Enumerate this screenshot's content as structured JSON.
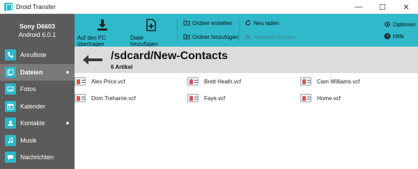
{
  "window": {
    "title": "Droid Transfer",
    "controls": {
      "minimize": "—",
      "maximize": "☐",
      "close": "✕"
    }
  },
  "device": {
    "name": "Sony D6603",
    "os": "Android 6.0.1"
  },
  "sidebar": {
    "items": [
      {
        "label": "Anrufliste",
        "icon": "phone-icon",
        "active": false,
        "dot": false
      },
      {
        "label": "Dateien",
        "icon": "files-icon",
        "active": true,
        "dot": true
      },
      {
        "label": "Fotos",
        "icon": "photos-icon",
        "active": false,
        "dot": false
      },
      {
        "label": "Kalender",
        "icon": "calendar-icon",
        "active": false,
        "dot": false
      },
      {
        "label": "Kontakte",
        "icon": "contacts-icon",
        "active": false,
        "dot": true
      },
      {
        "label": "Musik",
        "icon": "music-icon",
        "active": false,
        "dot": false
      },
      {
        "label": "Nachrichten",
        "icon": "messages-icon",
        "active": false,
        "dot": false
      }
    ]
  },
  "toolbar": {
    "copy_to_pc": "Auf den PC übertragen",
    "add_file": "Datei hinzufügen",
    "create_folder": "Ordner erstellen",
    "add_folder": "Ordner hinzufügen",
    "reload": "Neu laden",
    "delete_selection": "Auswahl löschen",
    "options": "Optionen",
    "help": "Hilfe"
  },
  "path": {
    "title": "/sdcard/New-Contacts",
    "count": "6 Artikel"
  },
  "files": [
    {
      "name": "Alex Price.vcf"
    },
    {
      "name": "Brett Heath.vcf"
    },
    {
      "name": "Cam Williams.vcf"
    },
    {
      "name": "Dom Treharne.vcf"
    },
    {
      "name": "Faye.vcf"
    },
    {
      "name": "Home.vcf"
    }
  ],
  "colors": {
    "accent": "#2fb9cb",
    "sidebar": "#5b5b5b",
    "sidebar_active": "#7a7a7a",
    "path_bar": "#dcdcdc"
  }
}
